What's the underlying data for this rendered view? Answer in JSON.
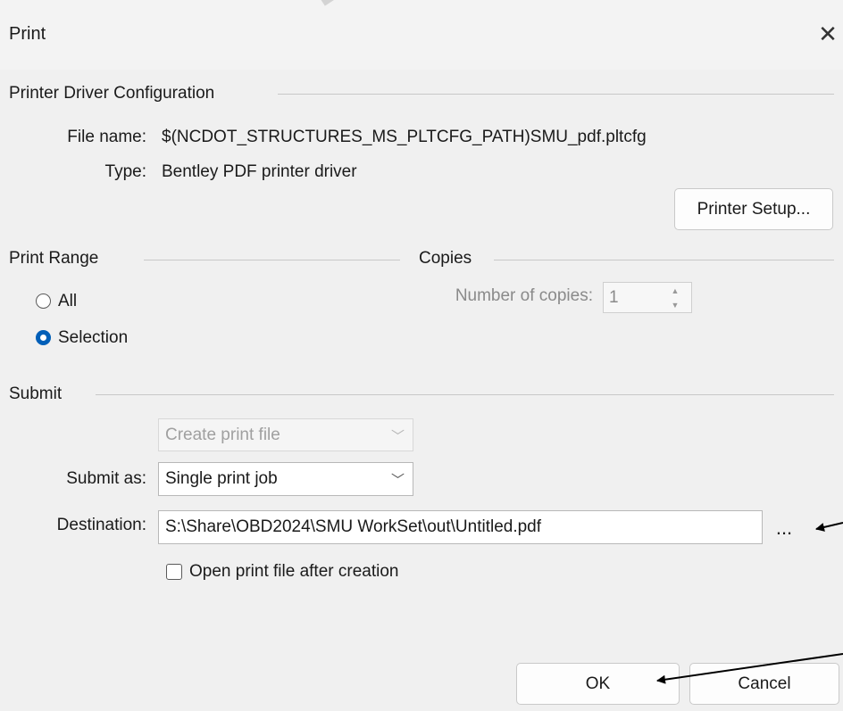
{
  "watermark": "DRA",
  "window": {
    "title": "Print"
  },
  "driver": {
    "group_label": "Printer Driver Configuration",
    "file_name_label": "File name:",
    "file_name_value": "$(NCDOT_STRUCTURES_MS_PLTCFG_PATH)SMU_pdf.pltcfg",
    "type_label": "Type:",
    "type_value": "Bentley PDF printer driver",
    "setup_button": "Printer Setup..."
  },
  "print_range": {
    "group_label": "Print Range",
    "options": [
      {
        "label": "All",
        "checked": false
      },
      {
        "label": "Selection",
        "checked": true
      }
    ]
  },
  "copies": {
    "group_label": "Copies",
    "label": "Number of copies:",
    "value": "1"
  },
  "submit": {
    "group_label": "Submit",
    "create_print_file": "Create print file",
    "submit_as_label": "Submit as:",
    "submit_as_value": "Single print job",
    "destination_label": "Destination:",
    "destination_value": "S:\\Share\\OBD2024\\SMU WorkSet\\out\\Untitled.pdf",
    "browse_button": "...",
    "open_after_label": "Open print file after creation",
    "open_after_checked": false
  },
  "buttons": {
    "ok": "OK",
    "cancel": "Cancel"
  },
  "colors": {
    "accent": "#005fb8",
    "background": "#f0f0f0"
  }
}
